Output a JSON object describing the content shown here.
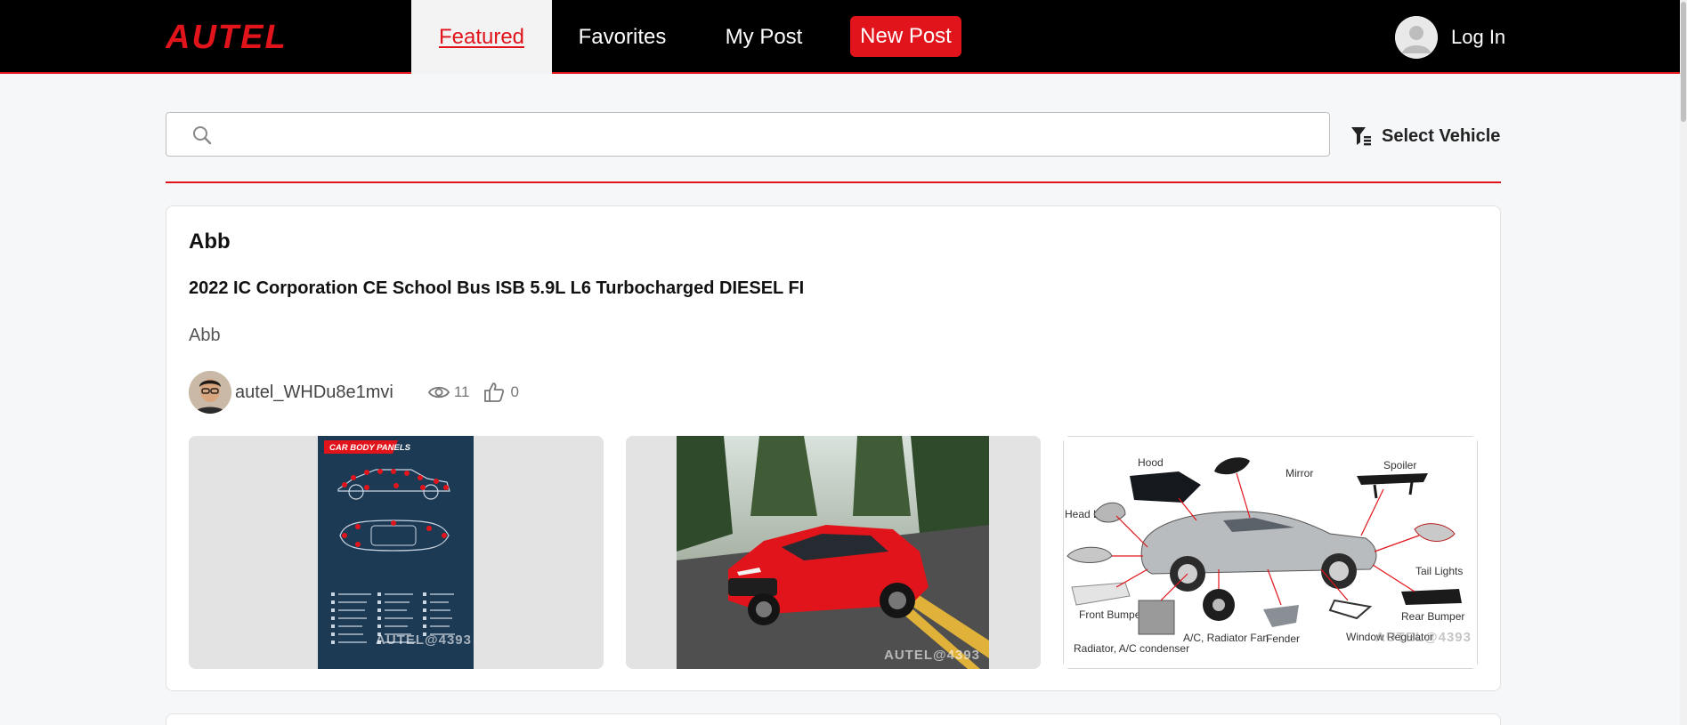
{
  "header": {
    "brand": "AUTEL",
    "tabs": [
      {
        "label": "Featured"
      },
      {
        "label": "Favorites"
      },
      {
        "label": "My Post"
      }
    ],
    "new_post_label": "New Post",
    "login_label": "Log In"
  },
  "search": {
    "placeholder": "",
    "select_vehicle_label": "Select Vehicle"
  },
  "post": {
    "title": "Abb",
    "vehicle": "2022 IC Corporation CE School Bus ISB 5.9L L6 Turbocharged DIESEL FI",
    "body": "Abb",
    "author": "autel_WHDu8e1mvi",
    "views": "11",
    "likes": "0",
    "images": [
      {
        "caption": "CAR BODY PANELS",
        "watermark": "AUTEL@4393"
      },
      {
        "watermark": "AUTEL@4393"
      },
      {
        "watermark": "AUTEL@4393",
        "labels": [
          "Hood",
          "Mirror",
          "Spoiler",
          "Head Lights",
          "Tail Lights",
          "Front Bumper",
          "Rear Bumper",
          "Radiator, A/C condenser",
          "A/C, Radiator Fan",
          "Fender",
          "Window Regulator"
        ]
      }
    ]
  },
  "colors": {
    "accent": "#e1141b",
    "header_bg": "#000000",
    "page_bg": "#f6f7f8"
  }
}
